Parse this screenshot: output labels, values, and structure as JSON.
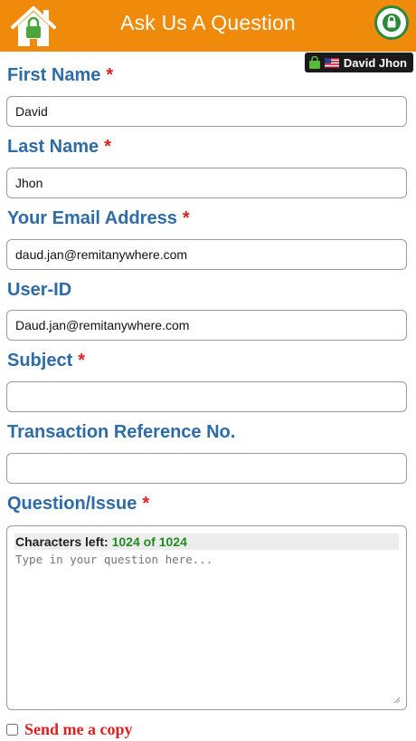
{
  "header": {
    "title": "Ask Us A Question",
    "user_name": "David Jhon"
  },
  "form": {
    "first_name": {
      "label": "First Name",
      "required": "*",
      "value": "David"
    },
    "last_name": {
      "label": "Last Name",
      "required": "*",
      "value": "Jhon"
    },
    "email": {
      "label": "Your Email Address",
      "required": "*",
      "value": "daud.jan@remitanywhere.com"
    },
    "user_id": {
      "label": "User-ID",
      "value": "Daud.jan@remitanywhere.com"
    },
    "subject": {
      "label": "Subject",
      "required": "*",
      "value": ""
    },
    "transaction_ref": {
      "label": "Transaction Reference No.",
      "value": ""
    },
    "question": {
      "label": "Question/Issue",
      "required": "*",
      "chars_left_label": "Characters left:",
      "chars_left_count": "1024 of 1024",
      "placeholder": "Type in your question here..."
    },
    "send_copy": {
      "label": "Send me a copy",
      "checked": false
    }
  },
  "colors": {
    "header_bg": "#f08a0a",
    "label": "#2d6ca8",
    "required": "#e02020",
    "count": "#1f8c1f"
  },
  "icons": {
    "home": "home-icon",
    "logout": "power-lock-icon",
    "user_lock": "lock-icon",
    "flag": "us-flag-icon"
  }
}
